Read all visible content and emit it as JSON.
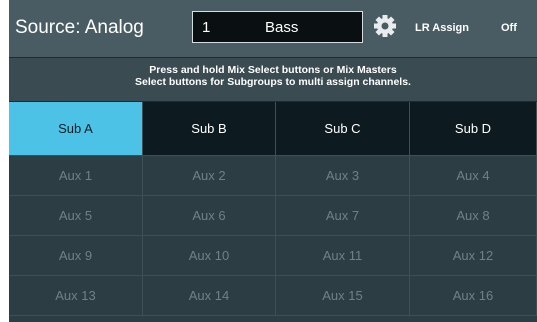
{
  "header": {
    "source_label": "Source: Analog",
    "channel_number": "1",
    "channel_name": "Bass",
    "lr_assign_label": "LR Assign",
    "lr_assign_state": "Off"
  },
  "info": {
    "line1": "Press and hold Mix Select buttons or Mix Masters",
    "line2": "Select buttons for Subgroups to multi assign channels."
  },
  "subgroups": [
    {
      "label": "Sub A",
      "selected": true
    },
    {
      "label": "Sub B",
      "selected": false
    },
    {
      "label": "Sub C",
      "selected": false
    },
    {
      "label": "Sub D",
      "selected": false
    }
  ],
  "aux_rows": [
    [
      "Aux 1",
      "Aux 2",
      "Aux 3",
      "Aux 4"
    ],
    [
      "Aux 5",
      "Aux 6",
      "Aux 7",
      "Aux 8"
    ],
    [
      "Aux 9",
      "Aux 10",
      "Aux 11",
      "Aux 12"
    ],
    [
      "Aux 13",
      "Aux 14",
      "Aux 15",
      "Aux 16"
    ]
  ],
  "colors": {
    "accent": "#4cc3e6",
    "background": "#2c3d44",
    "header": "#4a5c63"
  },
  "icons": {
    "settings": "gear-icon"
  }
}
